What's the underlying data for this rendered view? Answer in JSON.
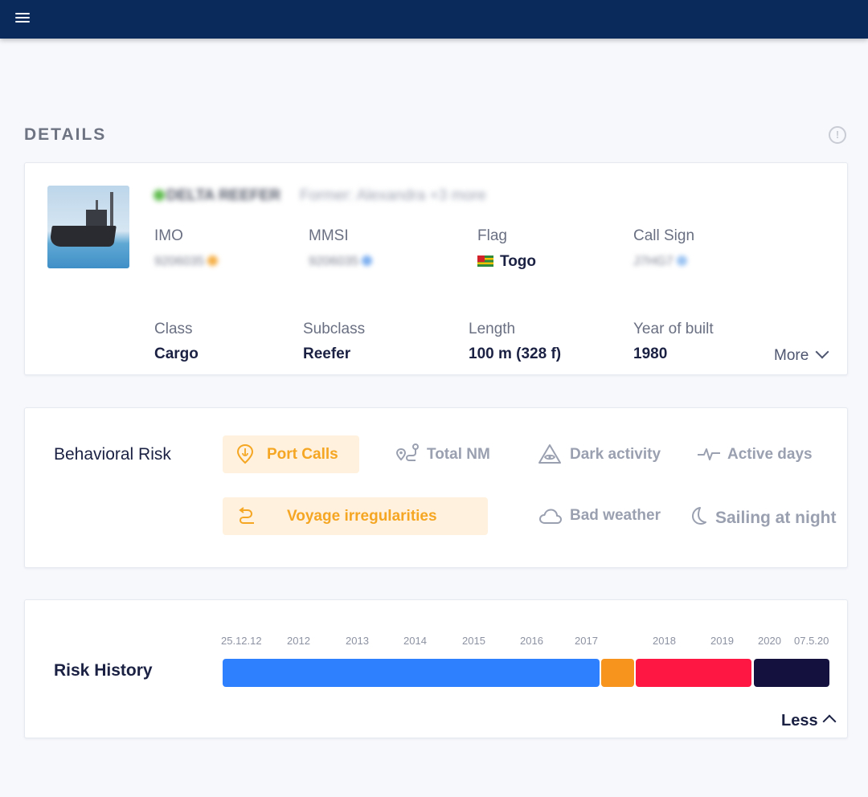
{
  "app": {
    "menu_icon": "hamburger-menu-icon",
    "header_color": "#0a2a5c"
  },
  "details": {
    "title": "DETAILS",
    "info_icon_glyph": "!",
    "vessel_name": "DELTA REEFER",
    "vessel_former": "Former: Alexandra +3 more",
    "fields_row1": [
      {
        "label": "IMO",
        "value": "9206035"
      },
      {
        "label": "MMSI",
        "value": "9206035"
      },
      {
        "label": "Flag",
        "value": "Togo"
      },
      {
        "label": "Call Sign",
        "value": "J7HG7"
      }
    ],
    "fields_row2": [
      {
        "label": "Class",
        "value": "Cargo"
      },
      {
        "label": "Subclass",
        "value": "Reefer"
      },
      {
        "label": "Length",
        "value": "100 m (328 f)"
      },
      {
        "label": "Year of built",
        "value": "1980"
      }
    ],
    "more_label": "More"
  },
  "behavioral_risk": {
    "title": "Behavioral Risk",
    "chips": [
      {
        "label": "Port Calls",
        "icon": "anchor-pin-icon",
        "active": true
      },
      {
        "label": "Total NM",
        "icon": "route-icon",
        "active": false
      },
      {
        "label": "Dark activity",
        "icon": "dark-activity-icon",
        "active": false
      },
      {
        "label": "Active days",
        "icon": "pulse-icon",
        "active": false
      },
      {
        "label": "Voyage irregularities",
        "icon": "voyage-icon",
        "active": true
      },
      {
        "label": "Bad weather",
        "icon": "cloud-icon",
        "active": false
      },
      {
        "label": "Sailing at night",
        "icon": "moon-icon",
        "active": false
      }
    ],
    "active_color": "#f5a623"
  },
  "risk_history": {
    "title": "Risk History",
    "ticks": [
      "25.12.12",
      "2012",
      "2013",
      "2014",
      "2015",
      "2016",
      "2017",
      "2018",
      "2019",
      "2020",
      "07.5.20"
    ],
    "segments": [
      {
        "color": "#2f80ff"
      },
      {
        "color": "#f7941d"
      },
      {
        "color": "#ff1744"
      },
      {
        "color": "#14113f"
      }
    ],
    "less_label": "Less"
  }
}
